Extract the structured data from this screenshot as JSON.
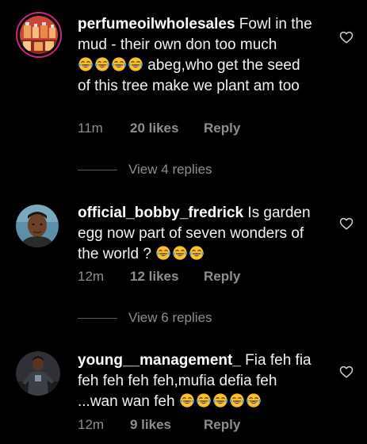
{
  "comments": [
    {
      "username": "perfumeoilwholesales",
      "text_part1": " Fowl in the mud - their own don too much",
      "emoji_count_1": 4,
      "text_part2": " abeg,who get the seed of this tree make we plant am too",
      "time": "11m",
      "likes": "20 likes",
      "reply_label": "Reply",
      "view_replies": "View 4 replies",
      "avatar_icon": "perfume-bottles-avatar"
    },
    {
      "username": "official_bobby_fredrick",
      "text_part1": " Is garden egg now part of seven wonders of the world ? ",
      "emoji_count_1": 3,
      "time": "12m",
      "likes": "12 likes",
      "reply_label": "Reply",
      "view_replies": "View 6 replies",
      "avatar_icon": "man-portrait-avatar"
    },
    {
      "username": "young__management_",
      "text_part1": " Fia feh fia feh feh feh feh,mufia defia feh ...wan wan feh ",
      "emoji_count_1": 5,
      "time": "12m",
      "likes": "9 likes",
      "reply_label": "Reply",
      "avatar_icon": "man-standing-avatar"
    }
  ],
  "emoji_name": "face-with-tears-of-joy-emoji",
  "colors": {
    "background": "#000000",
    "meta_gray": "#8e8e8e",
    "story_ring": "#c6297f",
    "emoji_yellow": "#f7c12c",
    "tears_blue": "#4aa3df"
  }
}
